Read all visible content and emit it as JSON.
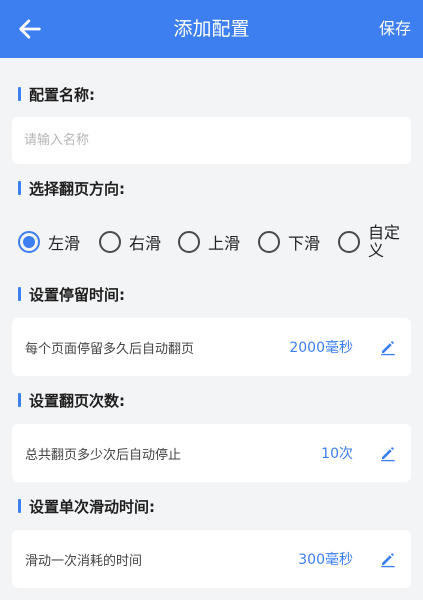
{
  "header": {
    "title": "添加配置",
    "save_label": "保存",
    "back_icon": "arrow-left-icon"
  },
  "colors": {
    "accent": "#3d7ff0",
    "background": "#f3f4f6"
  },
  "name_section": {
    "label": "配置名称:",
    "placeholder": "请输入名称",
    "value": ""
  },
  "direction_section": {
    "label": "选择翻页方向:",
    "options": [
      {
        "label": "左滑",
        "selected": true
      },
      {
        "label": "右滑",
        "selected": false
      },
      {
        "label": "上滑",
        "selected": false
      },
      {
        "label": "下滑",
        "selected": false
      },
      {
        "label": "自定义",
        "selected": false
      }
    ]
  },
  "stay_section": {
    "label": "设置停留时间:",
    "description": "每个页面停留多久后自动翻页",
    "value": "2000毫秒",
    "edit_icon": "pencil-icon"
  },
  "count_section": {
    "label": "设置翻页次数:",
    "description": "总共翻页多少次后自动停止",
    "value": "10次",
    "edit_icon": "pencil-icon"
  },
  "swipe_section": {
    "label": "设置单次滑动时间:",
    "description": "滑动一次消耗的时间",
    "value": "300毫秒",
    "edit_icon": "pencil-icon"
  }
}
